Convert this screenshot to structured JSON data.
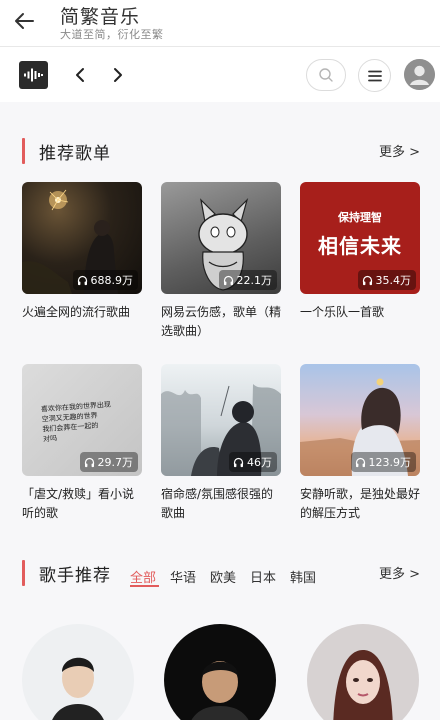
{
  "app": {
    "title": "简繁音乐",
    "subtitle": "大道至简，衍化至繁"
  },
  "recommend": {
    "title": "推荐歌单",
    "more": "更多 >",
    "playlists": [
      {
        "title": "火遍全网的流行歌曲",
        "plays": "688.9万"
      },
      {
        "title": "网易云伤感，歌单（精选歌曲）",
        "plays": "22.1万"
      },
      {
        "title": "一个乐队一首歌",
        "plays": "35.4万",
        "cover_text_top": "保持理智",
        "cover_text_main": "相信未来"
      },
      {
        "title": "「虐文/救赎」看小说听的歌",
        "plays": "29.7万",
        "cover_text_lines": [
          "喜欢你在我的世界出现",
          "空洞又无趣的世界",
          "我们会葬在一起的",
          "对吗"
        ]
      },
      {
        "title": "宿命感/氛围感很强的歌曲",
        "plays": "46万"
      },
      {
        "title": "安静听歌，是独处最好的解压方式",
        "plays": "123.9万"
      }
    ]
  },
  "singers": {
    "title": "歌手推荐",
    "more": "更多 >",
    "tabs": [
      "全部",
      "华语",
      "欧美",
      "日本",
      "韩国"
    ],
    "active_tab": "全部"
  },
  "colors": {
    "accent": "#e25c5c",
    "background": "#f7f7f9"
  }
}
